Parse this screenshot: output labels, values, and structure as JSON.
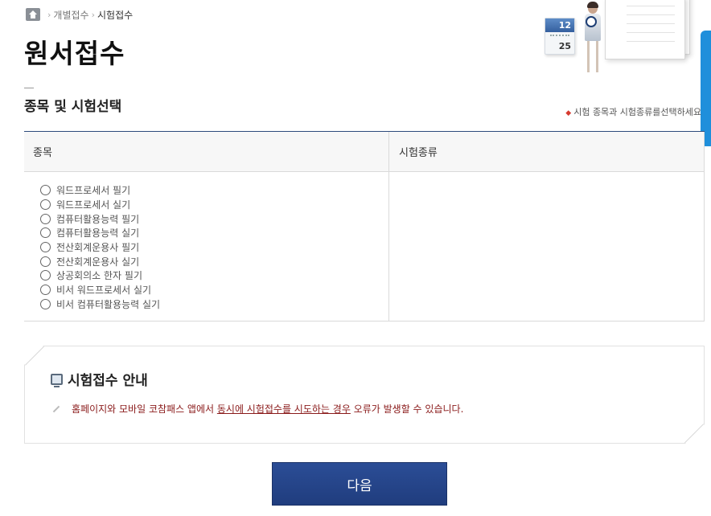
{
  "breadcrumb": {
    "home_icon": "home-icon",
    "items": [
      "개별접수",
      "시험접수"
    ]
  },
  "page_title": "원서접수",
  "section": {
    "title": "종목 및 시험선택",
    "notice": "시험 종목과 시험종류를선택하세요"
  },
  "table": {
    "headers": [
      "종목",
      "시험종류"
    ],
    "subjects": [
      "워드프로세서 필기",
      "워드프로세서 실기",
      "컴퓨터활용능력 필기",
      "컴퓨터활용능력 실기",
      "전산회계운용사 필기",
      "전산회계운용사 실기",
      "상공회의소 한자 필기",
      "비서 워드프로세서 실기",
      "비서 컴퓨터활용능력 실기"
    ]
  },
  "hero": {
    "calendar_top": "12",
    "calendar_bottom": "25"
  },
  "guide": {
    "title": "시험접수 안내",
    "text_before": "홈페이지와 모바일 코참패스 앱에서 ",
    "text_underline": "동시에 시험접수를 시도하는 경우",
    "text_after": " 오류가 발생할 수 있습니다."
  },
  "next_button": "다음",
  "colors": {
    "primary": "#243f88",
    "side_tab": "#1f8fdb",
    "warning_text": "#8a1a1a",
    "notice_icon": "#d63a2f"
  }
}
